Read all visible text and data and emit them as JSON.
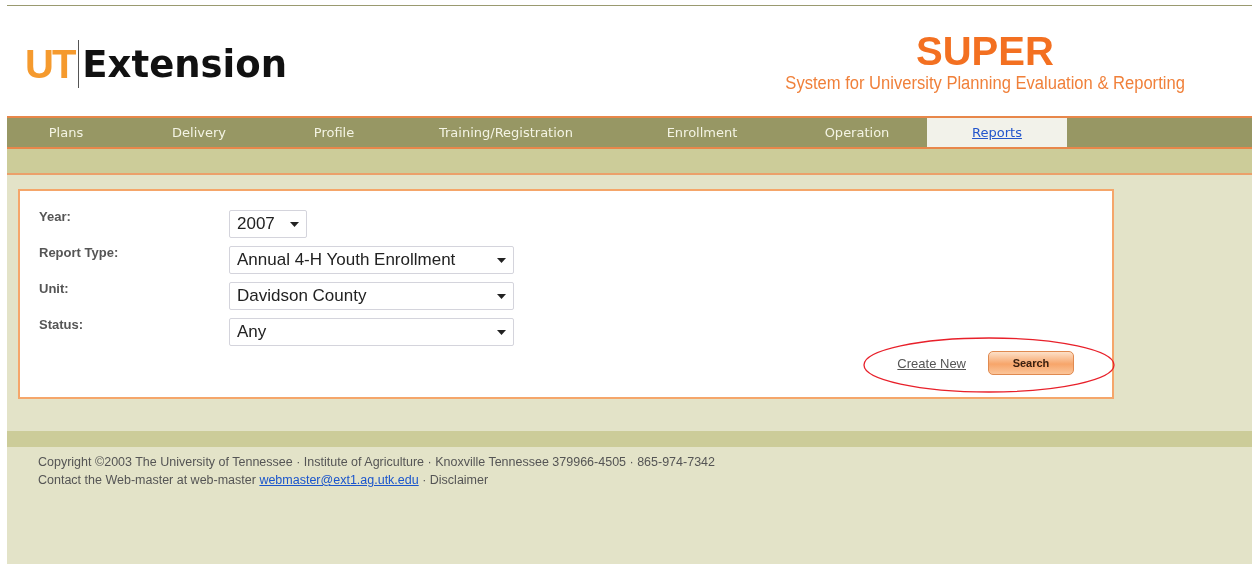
{
  "header": {
    "logo_mark": "UT",
    "logo_text": "Extension",
    "app_name": "SUPER",
    "app_subtitle": "System for University Planning Evaluation & Reporting"
  },
  "tabs": [
    {
      "label": "Plans",
      "selected": false
    },
    {
      "label": "Delivery",
      "selected": false
    },
    {
      "label": "Profile",
      "selected": false
    },
    {
      "label": "Training/Registration",
      "selected": false
    },
    {
      "label": "Enrollment",
      "selected": false
    },
    {
      "label": "Operation",
      "selected": false
    },
    {
      "label": "Reports",
      "selected": true
    }
  ],
  "form": {
    "fields": [
      {
        "label": "Year:",
        "value": "2007",
        "kind": "short"
      },
      {
        "label": "Report Type:",
        "value": "Annual 4-H Youth Enrollment",
        "kind": "wide"
      },
      {
        "label": "Unit:",
        "value": "Davidson County",
        "kind": "wide"
      },
      {
        "label": "Status:",
        "value": "Any",
        "kind": "wide"
      }
    ],
    "create_link": "Create New",
    "search_button": "Search",
    "highlighted": true
  },
  "footer": {
    "copyright": "Copyright ©2003 The University of Tennessee · Institute of Agriculture · Knoxville Tennessee 379966-4505 · 865-974-7342",
    "contact_text": "Contact the Web-master at web-master",
    "email_link": "webmaster@ext1.ag.utk.edu",
    "contact_tail": "· Disclaimer"
  }
}
